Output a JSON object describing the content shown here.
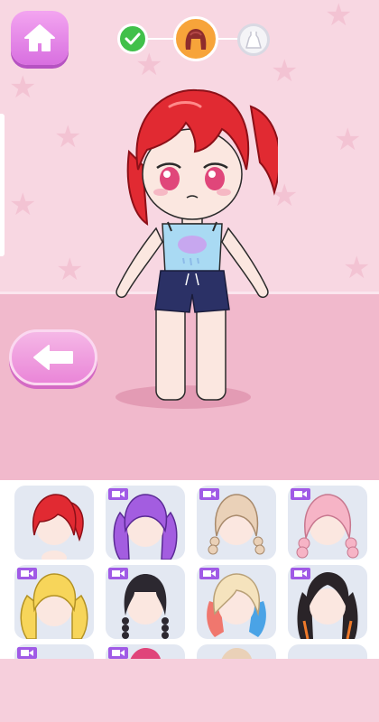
{
  "app": {
    "screen": "hair-selection"
  },
  "icons": {
    "home": "home-icon",
    "back": "arrow-left-icon",
    "step1": "checkmark-icon",
    "step2": "hair-icon",
    "step3": "dress-icon",
    "video_ad": "video-camera-icon"
  },
  "progress": {
    "steps_total": 3,
    "current_step": 2,
    "completed_steps": 1
  },
  "colors": {
    "accent": "#d86fe0",
    "background": "#f8d7e2",
    "floor": "#f1b9cc",
    "selected_hair": "#e12a32"
  },
  "hair_options": [
    {
      "name": "red-side-ponytail",
      "color": "#e12a32",
      "locked_video": false
    },
    {
      "name": "purple-twin-tails",
      "color": "#a35de0",
      "locked_video": true
    },
    {
      "name": "beige-braids",
      "color": "#ead1b8",
      "locked_video": true
    },
    {
      "name": "pink-braids",
      "color": "#f6b4c6",
      "locked_video": true
    },
    {
      "name": "blonde-twin-tails",
      "color": "#f7d55a",
      "locked_video": true
    },
    {
      "name": "black-braids",
      "color": "#2c2830",
      "locked_video": true
    },
    {
      "name": "blonde-red-blue-ombre",
      "color": "#f5e3bd",
      "locked_video": true
    },
    {
      "name": "black-orange-long",
      "color": "#2a2428",
      "locked_video": true
    }
  ]
}
